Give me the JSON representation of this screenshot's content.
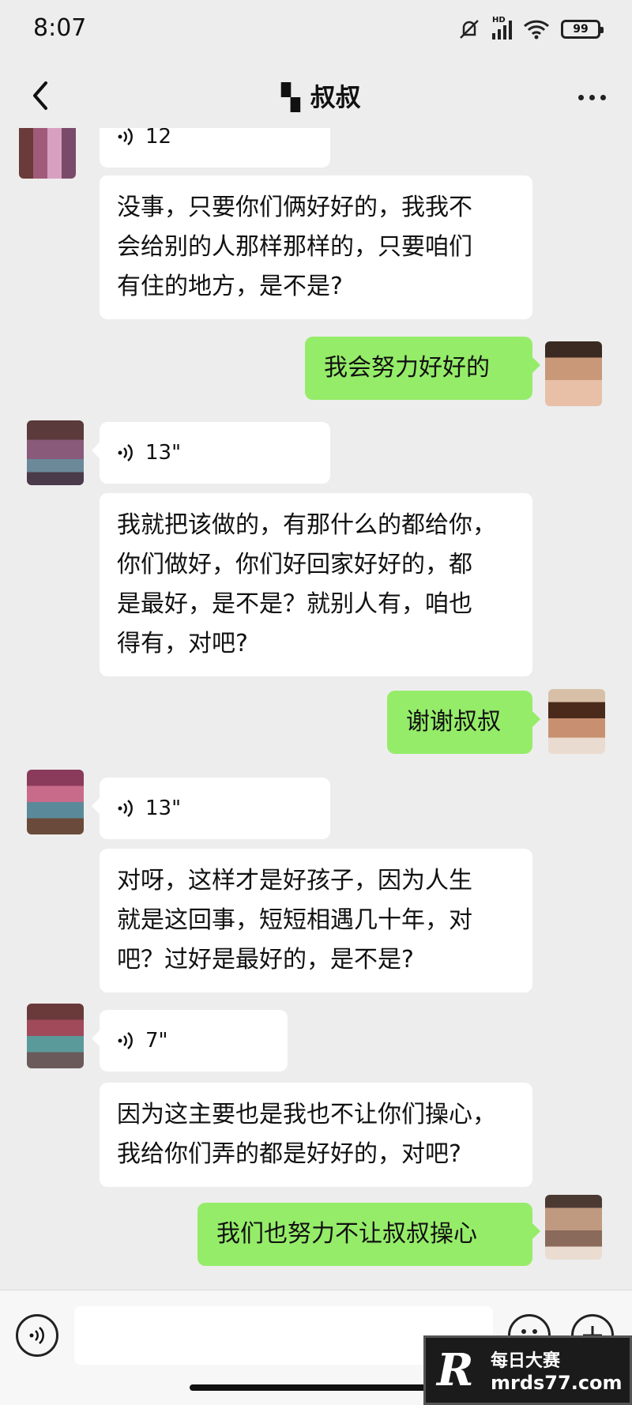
{
  "status": {
    "time": "8:07",
    "battery": "99",
    "network": "HD"
  },
  "header": {
    "title": "▝▖叔叔"
  },
  "messages": [
    {
      "side": "left",
      "type": "voice",
      "text": "12"
    },
    {
      "side": "left",
      "type": "text",
      "lines": [
        "没事，只要你们俩好好的，我我不",
        "会给别的人那样那样的，只要咱们",
        "有住的地方，是不是?"
      ]
    },
    {
      "side": "right",
      "type": "text",
      "lines": [
        "我会努力好好的"
      ]
    },
    {
      "side": "left",
      "type": "voice",
      "text": "13\""
    },
    {
      "side": "left",
      "type": "text",
      "lines": [
        "我就把该做的，有那什么的都给你，",
        "你们做好，你们好回家好好的，都",
        "是最好，是不是？就别人有，咱也",
        "得有，对吧?"
      ]
    },
    {
      "side": "right",
      "type": "text",
      "lines": [
        "谢谢叔叔"
      ]
    },
    {
      "side": "left",
      "type": "voice",
      "text": "13\""
    },
    {
      "side": "left",
      "type": "text",
      "lines": [
        "对呀，这样才是好孩子，因为人生",
        "就是这回事，短短相遇几十年，对",
        "吧？过好是最好的，是不是?"
      ]
    },
    {
      "side": "left",
      "type": "voice",
      "text": "7\""
    },
    {
      "side": "left",
      "type": "text",
      "lines": [
        "因为这主要也是我也不让你们操心，",
        "我给你们弄的都是好好的，对吧?"
      ]
    },
    {
      "side": "right",
      "type": "text",
      "lines": [
        "我们也努力不让叔叔操心"
      ]
    }
  ],
  "watermark": {
    "cn": "每日大赛",
    "url": "mrds77.com",
    "logo": "R"
  },
  "colors": {
    "background": "#ededed",
    "bubble_me": "#95ec69",
    "bubble_other": "#ffffff"
  }
}
